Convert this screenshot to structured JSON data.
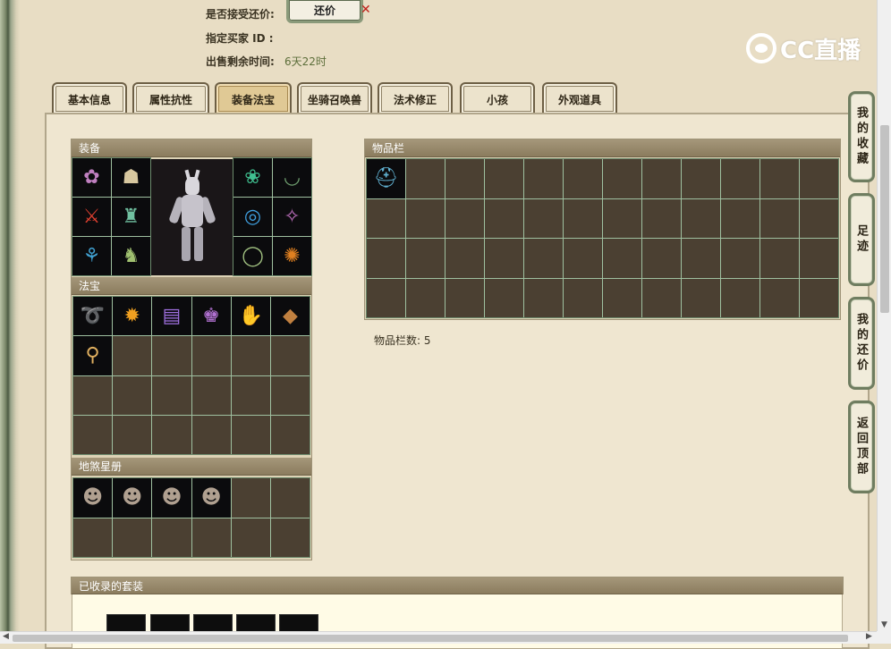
{
  "info": {
    "accept_counter_label": "是否接受还价:",
    "counter_button": "还价",
    "buyer_id_label": "指定买家 ID :",
    "time_left_label": "出售剩余时间:",
    "time_left_value": "6天22时"
  },
  "logo_text": "CC直播",
  "tabs": [
    "基本信息",
    "属性抗性",
    "装备法宝",
    "坐骑召唤兽",
    "法术修正",
    "小孩",
    "外观道具"
  ],
  "active_tab": "装备法宝",
  "equip_panel": {
    "title": "装备"
  },
  "treasure_panel": {
    "title": "法宝"
  },
  "star_panel": {
    "title": "地煞星册"
  },
  "inventory_panel": {
    "title": "物品栏"
  },
  "inventory_count": "物品栏数:  5",
  "suit_panel": {
    "title": "已收录的套装"
  },
  "side_buttons": [
    "我的收藏",
    "足迹",
    "我的还价",
    "返回顶部"
  ],
  "colors": {
    "background": "#e8ddc4",
    "cell_empty": "#4b4032",
    "grid_line": "#9fc0a0",
    "header": "#8b7c5e",
    "accent_green": "#5c6e3a"
  }
}
